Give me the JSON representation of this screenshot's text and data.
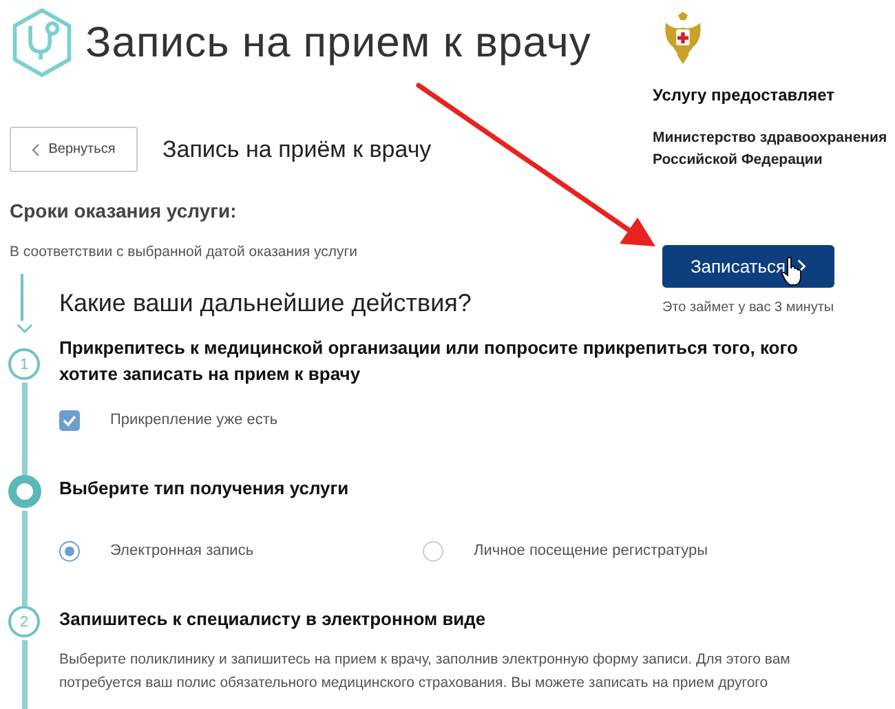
{
  "header": {
    "title": "Запись на прием к врачу"
  },
  "back_button": "Вернуться",
  "page_title": "Запись на приём к врачу",
  "terms": {
    "label": "Сроки оказания услуги:",
    "text": "В соответствии с выбранной датой оказания услуги"
  },
  "provider": {
    "label": "Услугу предоставляет",
    "name": "Министерство здравоохранения Российской Федерации"
  },
  "action": {
    "button": "Записаться",
    "note": "Это займет у вас 3 минуты"
  },
  "question": "Какие ваши дальнейшие действия?",
  "steps": [
    {
      "kind": "numbered",
      "number": "1",
      "title": "Прикрепитесь к медицинской организации или попросите прикрепиться того, кого хотите записать на прием к врачу",
      "options": [
        {
          "kind": "checkbox",
          "label": "Прикрепление уже есть",
          "checked": true
        }
      ]
    },
    {
      "kind": "current",
      "title": "Выберите тип получения услуги",
      "options": [
        {
          "kind": "radio",
          "label": "Электронная запись",
          "selected": true
        },
        {
          "kind": "radio",
          "label": "Личное посещение регистратуры",
          "selected": false
        }
      ]
    },
    {
      "kind": "numbered",
      "number": "2",
      "title": "Запишитесь к специалисту в электронном виде",
      "text": "Выберите поликлинику и запишитесь на прием к врачу, заполнив электронную форму записи. Для этого вам потребуется ваш полис обязательного медицинского страхования. Вы можете записать на прием другого"
    }
  ]
}
